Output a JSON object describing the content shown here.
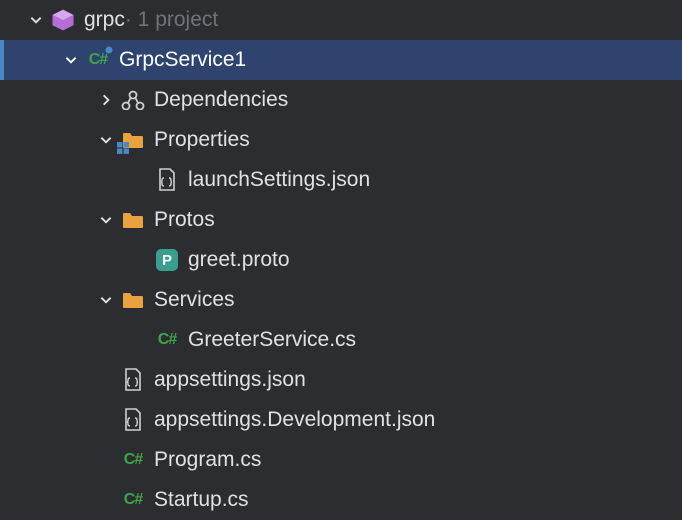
{
  "solution": {
    "name": "grpc",
    "suffix": " · 1 project"
  },
  "project": {
    "name": "GrpcService1"
  },
  "nodes": {
    "dependencies": "Dependencies",
    "properties": "Properties",
    "launchSettings": "launchSettings.json",
    "protos": "Protos",
    "greetProto": "greet.proto",
    "services": "Services",
    "greeterService": "GreeterService.cs",
    "appsettings": "appsettings.json",
    "appsettingsDev": "appsettings.Development.json",
    "program": "Program.cs",
    "startup": "Startup.cs"
  }
}
